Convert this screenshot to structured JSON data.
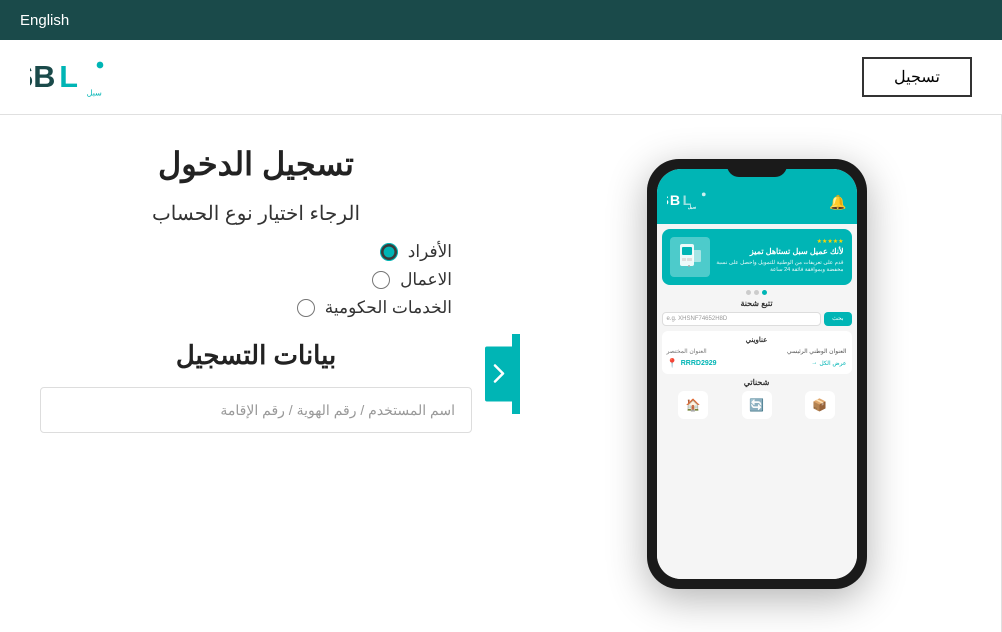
{
  "topbar": {
    "language_label": "English"
  },
  "header": {
    "register_button_label": "تسجيل",
    "logo_text": "سبل"
  },
  "phone": {
    "logo": "SBL",
    "banner_title": "لأنك عميل سبل تستاهل تميز",
    "banner_subtitle": "قدم على تعريفات من الوطنية للتمويل واحصل على نسبة مخفضة وبموافقة فائقة 24 ساعة",
    "stars": "★★★★★",
    "track_section_title": "تتبع شحنة",
    "track_placeholder": "e.g. XHSNF74652H8D",
    "track_button": "بحث",
    "address_section_title": "عناويني",
    "address_main_label": "العنوان الوطني الرئيسي",
    "address_sub_label": "العنوان المختصر",
    "address_code": "RRRD2929",
    "view_all_label": "عرض الكل",
    "shipments_title": "شحناتي"
  },
  "login_form": {
    "title": "تسجيل الدخول",
    "account_type_prompt": "الرجاء اختيار نوع الحساب",
    "radio_options": [
      {
        "id": "individuals",
        "label": "الأفراد",
        "checked": true
      },
      {
        "id": "business",
        "label": "الاعمال",
        "checked": false
      },
      {
        "id": "government",
        "label": "الخدمات الحكومية",
        "checked": false
      }
    ],
    "registration_data_title": "بيانات التسجيل",
    "username_placeholder": "اسم المستخدم / رقم الهوية / رقم الإقامة"
  },
  "colors": {
    "teal": "#00b5b5",
    "dark_nav": "#1a4a4a",
    "text_dark": "#222222",
    "text_mid": "#333333",
    "border": "#dddddd"
  }
}
